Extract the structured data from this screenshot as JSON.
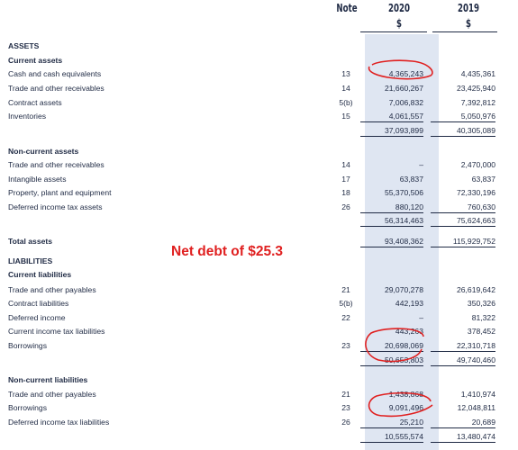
{
  "header": {
    "note": "Note",
    "year1": "2020",
    "year2": "2019",
    "cur1": "$",
    "cur2": "$"
  },
  "callout": "Net debt of $25.3",
  "rows": [
    {
      "label": "ASSETS",
      "note": "",
      "v2020": "",
      "v2019": ""
    },
    {
      "label": "Current assets",
      "note": "",
      "v2020": "",
      "v2019": ""
    },
    {
      "label": "Cash and cash equivalents",
      "note": "13",
      "v2020": "4,365,243",
      "v2019": "4,435,361"
    },
    {
      "label": "Trade and other receivables",
      "note": "14",
      "v2020": "21,660,267",
      "v2019": "23,425,940"
    },
    {
      "label": "Contract assets",
      "note": "5(b)",
      "v2020": "7,006,832",
      "v2019": "7,392,812"
    },
    {
      "label": "Inventories",
      "note": "15",
      "v2020": "4,061,557",
      "v2019": "5,050,976"
    },
    {
      "label": "",
      "note": "",
      "v2020": "37,093,899",
      "v2019": "40,305,089"
    },
    {
      "label": "Non-current assets",
      "note": "",
      "v2020": "",
      "v2019": ""
    },
    {
      "label": "Trade and other receivables",
      "note": "14",
      "v2020": "–",
      "v2019": "2,470,000"
    },
    {
      "label": "Intangible assets",
      "note": "17",
      "v2020": "63,837",
      "v2019": "63,837"
    },
    {
      "label": "Property, plant and equipment",
      "note": "18",
      "v2020": "55,370,506",
      "v2019": "72,330,196"
    },
    {
      "label": "Deferred income tax assets",
      "note": "26",
      "v2020": "880,120",
      "v2019": "760,630"
    },
    {
      "label": "",
      "note": "",
      "v2020": "56,314,463",
      "v2019": "75,624,663"
    },
    {
      "label": "Total assets",
      "note": "",
      "v2020": "93,408,362",
      "v2019": "115,929,752"
    },
    {
      "label": "LIABILITIES",
      "note": "",
      "v2020": "",
      "v2019": ""
    },
    {
      "label": "Current liabilities",
      "note": "",
      "v2020": "",
      "v2019": ""
    },
    {
      "label": "Trade and other payables",
      "note": "21",
      "v2020": "29,070,278",
      "v2019": "26,619,642"
    },
    {
      "label": "Contract liabilities",
      "note": "5(b)",
      "v2020": "442,193",
      "v2019": "350,326"
    },
    {
      "label": "Deferred income",
      "note": "22",
      "v2020": "–",
      "v2019": "81,322"
    },
    {
      "label": "Current income tax liabilities",
      "note": "",
      "v2020": "443,263",
      "v2019": "378,452"
    },
    {
      "label": "Borrowings",
      "note": "23",
      "v2020": "20,698,069",
      "v2019": "22,310,718"
    },
    {
      "label": "",
      "note": "",
      "v2020": "50,653,803",
      "v2019": "49,740,460"
    },
    {
      "label": "Non-current liabilities",
      "note": "",
      "v2020": "",
      "v2019": ""
    },
    {
      "label": "Trade and other payables",
      "note": "21",
      "v2020": "1,438,868",
      "v2019": "1,410,974"
    },
    {
      "label": "Borrowings",
      "note": "23",
      "v2020": "9,091,496",
      "v2019": "12,048,811"
    },
    {
      "label": "Deferred income tax liabilities",
      "note": "26",
      "v2020": "25,210",
      "v2019": "20,689"
    },
    {
      "label": "",
      "note": "",
      "v2020": "10,555,574",
      "v2019": "13,480,474"
    }
  ]
}
